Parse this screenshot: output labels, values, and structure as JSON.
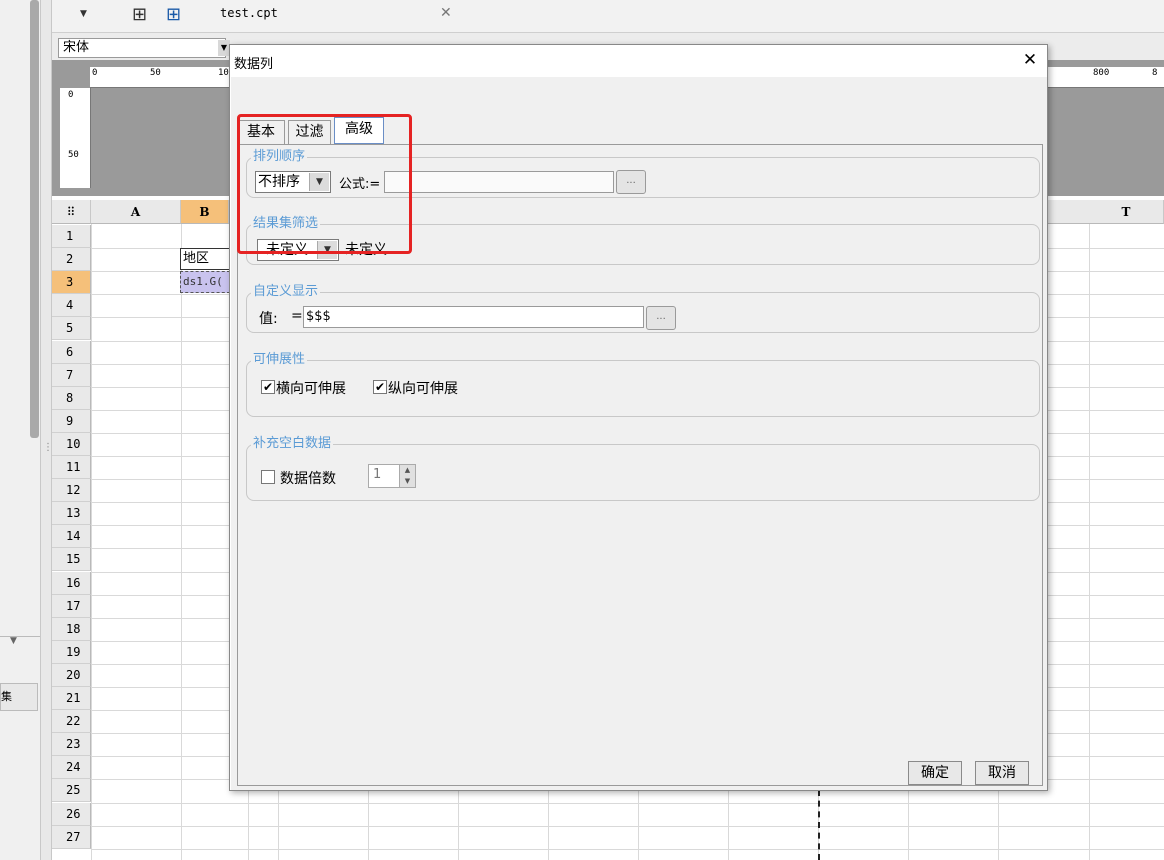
{
  "document": {
    "tab_name": "test.cpt",
    "font": "宋体"
  },
  "ruler": {
    "top_ticks": [
      "0",
      "50",
      "10",
      "800",
      "8"
    ],
    "left_ticks": [
      "0",
      "50"
    ]
  },
  "sheet": {
    "columns": [
      "A",
      "B",
      "T"
    ],
    "rows": [
      "1",
      "2",
      "3",
      "4",
      "5",
      "6",
      "7",
      "8",
      "9",
      "10",
      "11",
      "12",
      "13",
      "14",
      "15",
      "16",
      "17",
      "18",
      "19",
      "20",
      "21",
      "22",
      "23",
      "24",
      "25",
      "26",
      "27"
    ],
    "selected_row": "3",
    "cells": {
      "B2": "地区",
      "B3": "ds1.G("
    }
  },
  "left_panel": {
    "button_label": "集",
    "grip": "⋮"
  },
  "dialog": {
    "title": "数据列",
    "close_icon": "✕",
    "tabs": [
      {
        "label": "基本",
        "active": false
      },
      {
        "label": "过滤",
        "active": false
      },
      {
        "label": "高级",
        "active": true
      }
    ],
    "sort": {
      "title": "排列顺序",
      "selected": "不排序",
      "formula_label": "公式:=",
      "formula_value": "",
      "dots": "..."
    },
    "result_filter": {
      "title": "结果集筛选",
      "selected": "未定义",
      "description": "未定义"
    },
    "custom_display": {
      "title": "自定义显示",
      "value_label": "值:",
      "eq": "=",
      "value": "$$$",
      "dots": "..."
    },
    "expand": {
      "title": "可伸展性",
      "horizontal": {
        "label": "横向可伸展",
        "checked": true
      },
      "vertical": {
        "label": "纵向可伸展",
        "checked": true
      }
    },
    "fill_blank": {
      "title": "补充空白数据",
      "multiple_label": "数据倍数",
      "checked": false,
      "multiple_value": "1"
    },
    "ok_label": "确定",
    "cancel_label": "取消"
  },
  "colors": {
    "group_title": "#5b9bd5",
    "highlight": "#e52323",
    "selected_row_header": "#f5c07a",
    "selected_cell": "#c9c3ee"
  }
}
